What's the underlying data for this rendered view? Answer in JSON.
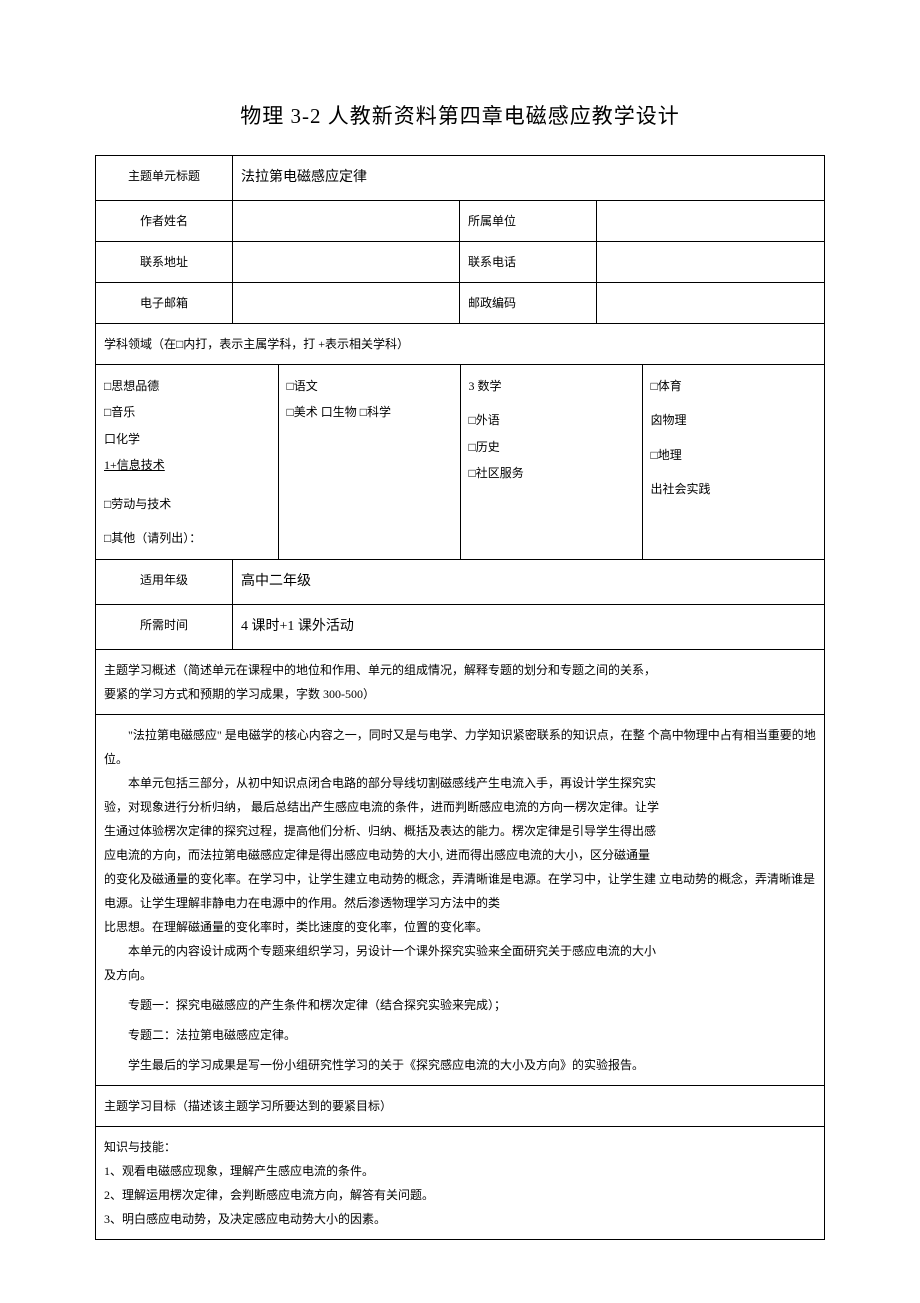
{
  "title": "物理 3-2 人教新资料第四章电磁感应教学设计",
  "rows": {
    "themeTitleLabel": "主题单元标题",
    "themeTitleValue": "法拉第电磁感应定律",
    "authorLabel": "作者姓名",
    "authorValue": "",
    "orgLabel": "所属单位",
    "orgValue": "",
    "addressLabel": "联系地址",
    "addressValue": "",
    "phoneLabel": "联系电话",
    "phoneValue": "",
    "emailLabel": "电子邮箱",
    "emailValue": "",
    "postalLabel": "邮政编码",
    "postalValue": ""
  },
  "domainHeader": "学科领域（在□内打，表示主属学科，打 +表示相关学科）",
  "subjects": {
    "c1l1": "□思想品德",
    "c1l2": "□音乐",
    "c1l3": "口化学",
    "c1l4": "1+信息技术",
    "c1l5": "□劳动与技术",
    "c1l6": "□其他（请列出）：",
    "c2l1": "□语文",
    "c2l2": "□美术 口生物 □科学",
    "c3l1": "3 数学",
    "c3l2": "□外语",
    "c3l3": "□历史",
    "c3l4": "□社区服务",
    "c4l1": "□体育",
    "c4l2": "囟物理",
    "c4l3": "□地理",
    "c4l4": "出社会实践"
  },
  "gradeLabel": "适用年级",
  "gradeValue": "高中二年级",
  "timeLabel": "所需时间",
  "timeValue": "4 课时+1 课外活动",
  "overviewHeader1": "主题学习概述（简述单元在课程中的地位和作用、单元的组成情况，解释专题的划分和专题之间的关系，",
  "overviewHeader2": "要紧的学习方式和预期的学习成果，字数 300-500）",
  "overview": {
    "p1": "\"法拉第电磁感应\" 是电磁学的核心内容之一，同时又是与电学、力学知识紧密联系的知识点，在整 个高中物理中占有相当重要的地位。",
    "p2a": "本单元包括三部分，从初中知识点闭合电路的部分导线切割磁感线产生电流入手，再设计学生探究实",
    "p2b": "验，对现象进行分析归纳， 最后总结出产生感应电流的条件，进而判断感应电流的方向一楞次定律。让学",
    "p2c": "生通过体验楞次定律的探究过程，提高他们分析、归纳、概括及表达的能力。楞次定律是引导学生得出感",
    "p2d": "应电流的方向，而法拉第电磁感应定律是得出感应电动势的大小, 进而得出感应电流的大小，区分磁通量",
    "p2e": "的变化及磁通量的变化率。在学习中，让学生建立电动势的概念，弄清晰谁是电源。在学习中，让学生建 立电动势的概念，弄清晰谁是电源。让学生理解非静电力在电源中的作用。然后渗透物理学习方法中的类",
    "p2f": "比思想。在理解磁通量的变化率时，类比速度的变化率，位置的变化率。",
    "p3a": "本单元的内容设计成两个专题来组织学习，另设计一个课外探究实验来全面研究关于感应电流的大小",
    "p3b": "及方向。",
    "t1": "专题一：探究电磁感应的产生条件和楞次定律（结合探究实验来完成）；",
    "t2": "专题二：法拉第电磁感应定律。",
    "final": "学生最后的学习成果是写一份小组研究性学习的关于《探究感应电流的大小及方向》的实验报告。"
  },
  "goalHeader": "主题学习目标（描述该主题学习所要达到的要紧目标）",
  "goals": {
    "h": "知识与技能：",
    "l1": "1、观看电磁感应现象，理解产生感应电流的条件。",
    "l2": "2、理解运用楞次定律，会判断感应电流方向，解答有关问题。",
    "l3": "3、明白感应电动势，及决定感应电动势大小的因素。"
  }
}
